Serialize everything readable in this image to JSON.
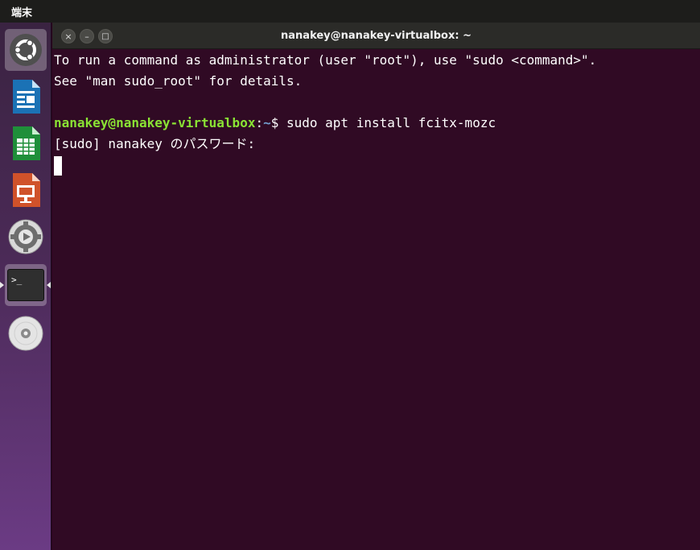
{
  "topbar": {
    "app_name": "端末"
  },
  "launcher": {
    "items": [
      {
        "name": "ubuntu-dash",
        "icon": "ubuntu-logo-icon"
      },
      {
        "name": "libreoffice-writer",
        "icon": "writer-icon"
      },
      {
        "name": "libreoffice-calc",
        "icon": "calc-icon"
      },
      {
        "name": "libreoffice-impress",
        "icon": "impress-icon"
      },
      {
        "name": "system-settings",
        "icon": "settings-gear-icon"
      },
      {
        "name": "terminal",
        "icon": "terminal-icon",
        "active": true
      },
      {
        "name": "dvd-drive",
        "icon": "disc-icon"
      }
    ],
    "terminal_icon_text": ">_"
  },
  "window": {
    "title": "nanakey@nanakey-virtualbox: ~",
    "close_glyph": "×",
    "minimize_glyph": "–",
    "maximize_glyph": "□"
  },
  "terminal": {
    "line1": "To run a command as administrator (user \"root\"), use \"sudo <command>\".",
    "line2": "See \"man sudo_root\" for details.",
    "prompt_user_host": "nanakey@nanakey-virtualbox",
    "prompt_colon": ":",
    "prompt_path": "~",
    "prompt_symbol": "$ ",
    "command": "sudo apt install fcitx-mozc",
    "password_prompt": "[sudo] nanakey のパスワード: "
  },
  "colors": {
    "terminal_bg": "#300a24",
    "prompt_user": "#8ae234",
    "prompt_path": "#729fcf",
    "titlebar_bg": "#2b2b28"
  }
}
